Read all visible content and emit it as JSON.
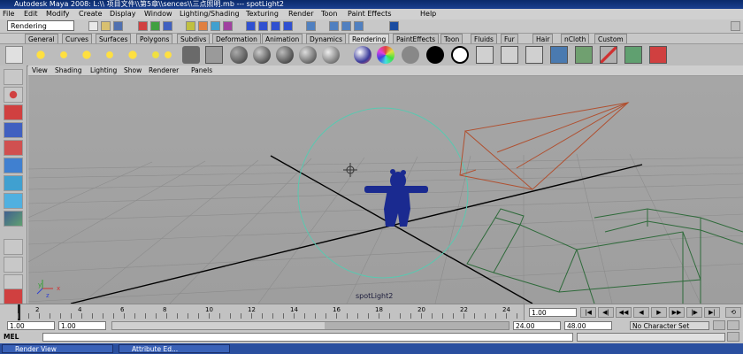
{
  "window": {
    "title": "Autodesk Maya 2008: L:\\\\ 项目文件\\\\第5章\\\\sences\\\\三点照明.mb  ---  spotLight2"
  },
  "menubar": {
    "items": [
      "File",
      "Edit",
      "Modify",
      "Create",
      "Display",
      "Window",
      "Lighting/Shading",
      "Texturing",
      "Render",
      "Toon",
      "Paint Effects",
      "Help"
    ]
  },
  "status_line": {
    "mode": "Rendering"
  },
  "shelf_tabs": [
    "General",
    "Curves",
    "Surfaces",
    "Polygons",
    "Subdivs",
    "Deformation",
    "Animation",
    "Dynamics",
    "Rendering",
    "PaintEffects",
    "Toon",
    "Fluids",
    "Fur",
    "Hair",
    "nCloth",
    "Custom"
  ],
  "active_shelf_tab": "Rendering",
  "panel_menu": [
    "View",
    "Shading",
    "Lighting",
    "Show",
    "Renderer",
    "Panels"
  ],
  "viewport": {
    "selected_label": "spotLight2",
    "axis_x": "x",
    "axis_y": "y",
    "axis_z": "z"
  },
  "timeline": {
    "ticks": [
      "2",
      "4",
      "6",
      "8",
      "10",
      "12",
      "14",
      "16",
      "18",
      "20",
      "22",
      "24"
    ],
    "current_frame": "1.00"
  },
  "range": {
    "start": "1.00",
    "start2": "1.00",
    "end": "24.00",
    "end2": "48.00",
    "character_set": "No Character Set"
  },
  "command_line": {
    "label": "MEL"
  },
  "taskbar": {
    "items": [
      "Render View",
      "Attribute Ed..."
    ]
  },
  "colors": {
    "light": "#b05030",
    "selection": "#5ac8b0",
    "character": "#1a2a90",
    "geometry": "#2e6a3a"
  }
}
